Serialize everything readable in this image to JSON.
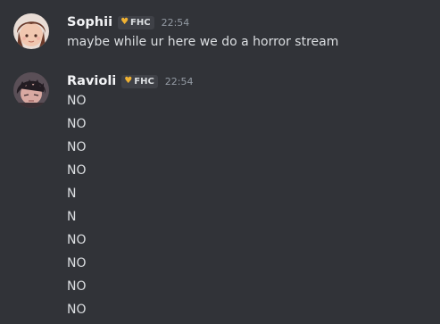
{
  "messages": [
    {
      "username": "Sophii",
      "tag": "FHC",
      "time": "22:54",
      "lines": [
        "maybe while ur here we do a horror stream"
      ]
    },
    {
      "username": "Ravioli",
      "tag": "FHC",
      "time": "22:54",
      "lines": [
        "NO",
        "NO",
        "NO",
        "NO",
        "N",
        "N",
        "NO",
        "NO",
        "NO",
        "NO"
      ]
    }
  ],
  "colors": {
    "background": "#313338",
    "tag_heart": "#f0b232",
    "username": "#f2f3f5",
    "timestamp": "#949ba4"
  },
  "icons": {
    "tag_icon": "yellow-heart-icon"
  }
}
